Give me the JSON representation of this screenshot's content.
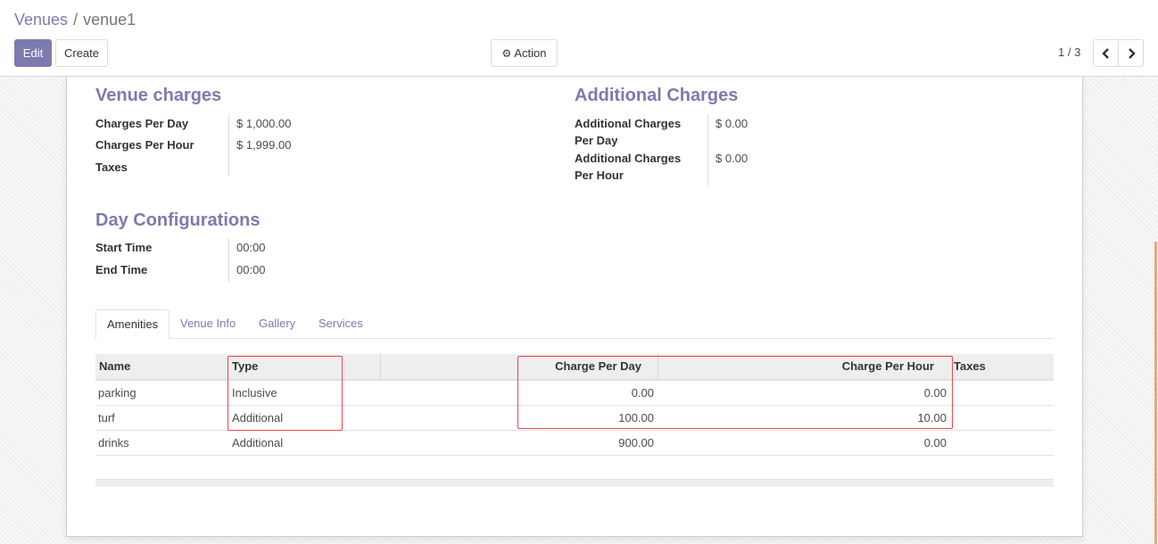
{
  "breadcrumb": {
    "parent": "Venues",
    "separator": "/",
    "current": "venue1"
  },
  "toolbar": {
    "edit_label": "Edit",
    "create_label": "Create",
    "action_label": "Action"
  },
  "pager": {
    "value": "1 / 3"
  },
  "venue_charges": {
    "title": "Venue charges",
    "fields": [
      {
        "label": "Charges Per Day",
        "value": "$ 1,000.00"
      },
      {
        "label": "Charges Per Hour",
        "value": "$ 1,999.00"
      },
      {
        "label": "Taxes",
        "value": ""
      }
    ]
  },
  "additional_charges": {
    "title": "Additional Charges",
    "fields": [
      {
        "label_line1": "Additional Charges",
        "label_line2": "Per Day",
        "value": "$ 0.00"
      },
      {
        "label_line1": "Additional Charges",
        "label_line2": "Per Hour",
        "value": "$ 0.00"
      }
    ]
  },
  "day_config": {
    "title": "Day Configurations",
    "fields": [
      {
        "label": "Start Time",
        "value": "00:00"
      },
      {
        "label": "End Time",
        "value": "00:00"
      }
    ]
  },
  "tabs": [
    {
      "label": "Amenities",
      "active": true
    },
    {
      "label": "Venue Info",
      "active": false
    },
    {
      "label": "Gallery",
      "active": false
    },
    {
      "label": "Services",
      "active": false
    }
  ],
  "table": {
    "columns": [
      "Name",
      "Type",
      "Charge Per Day",
      "Charge Per Hour",
      "Taxes"
    ],
    "rows": [
      {
        "name": "parking",
        "type": "Inclusive",
        "per_day": "0.00",
        "per_hour": "0.00",
        "taxes": ""
      },
      {
        "name": "turf",
        "type": "Additional",
        "per_day": "100.00",
        "per_hour": "10.00",
        "taxes": ""
      },
      {
        "name": "drinks",
        "type": "Additional",
        "per_day": "900.00",
        "per_hour": "0.00",
        "taxes": ""
      }
    ]
  },
  "colors": {
    "brand": "#7c7bad",
    "highlight": "#e8474d"
  },
  "icons": {
    "action": "gear-icon",
    "pager_prev": "chevron-left-icon",
    "pager_next": "chevron-right-icon"
  }
}
